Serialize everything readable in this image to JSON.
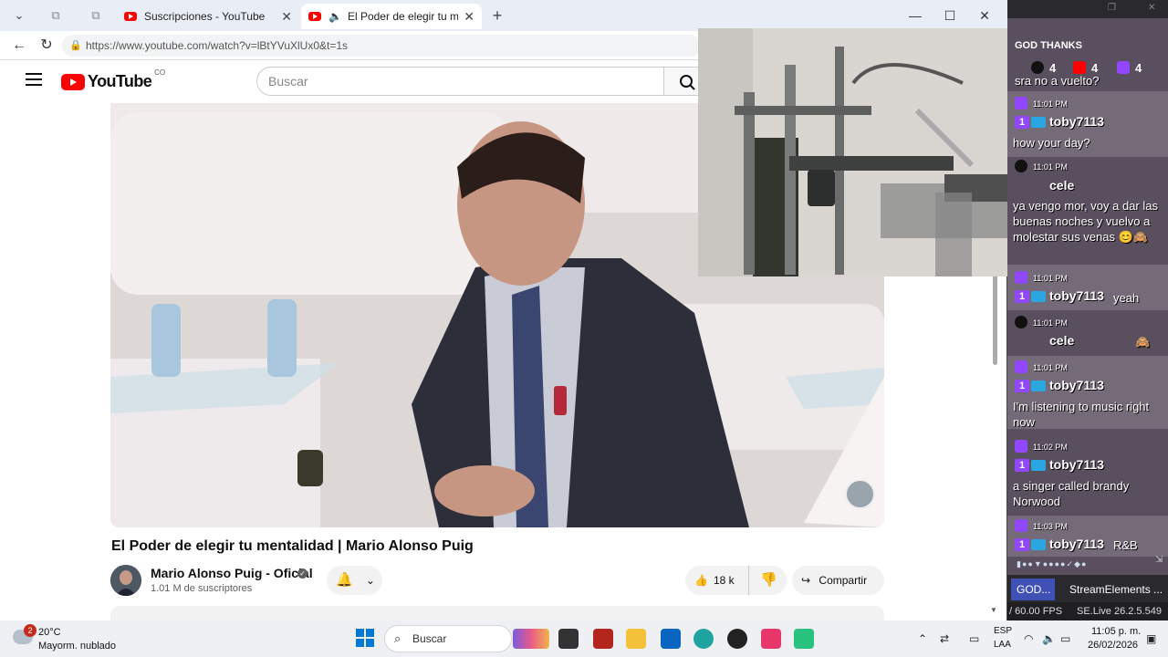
{
  "browser": {
    "tabs": [
      {
        "label": "Suscripciones - YouTube"
      },
      {
        "label": "El Poder de elegir tu mentalidad | Mario Alonso Puig"
      }
    ],
    "url": "https://www.youtube.com/watch?v=lBtYVuXlUx0&t=1s"
  },
  "youtube": {
    "logo_text": "YouTube",
    "country_code": "CO",
    "search_placeholder": "Buscar",
    "video_title": "El Poder de elegir tu mentalidad | Mario Alonso Puig",
    "channel_name": "Mario Alonso Puig - Oficial",
    "subscribers": "1.01 M de suscriptores",
    "likes": "18 k",
    "share_label": "Compartir"
  },
  "chat": {
    "header": "GOD THANKS",
    "counters": {
      "tiktok": "4",
      "youtube": "4",
      "twitch": "4"
    },
    "partial_top_line": "sra no a vuelto?",
    "messages": [
      {
        "platform": "twitch",
        "time": "11:01 PM",
        "user": "toby7113",
        "text": "how your day?"
      },
      {
        "platform": "tiktok",
        "time": "11:01 PM",
        "user": "cele",
        "text": "ya vengo mor, voy a dar las buenas noches y vuelvo a molestar sus venas 😊🙈"
      },
      {
        "platform": "twitch",
        "time": "11:01 PM",
        "user": "toby7113",
        "text": "yeah"
      },
      {
        "platform": "tiktok",
        "time": "11:01 PM",
        "user": "cele",
        "text": "🙈"
      },
      {
        "platform": "twitch",
        "time": "11:01 PM",
        "user": "toby7113",
        "text": "I'm listening to music right now"
      },
      {
        "platform": "twitch",
        "time": "11:02 PM",
        "user": "toby7113",
        "text": "a singer called brandy Norwood"
      },
      {
        "platform": "twitch",
        "time": "11:03 PM",
        "user": "toby7113",
        "text": "R&B"
      }
    ],
    "tabs": [
      "GOD...",
      "StreamElements ..."
    ],
    "fps": "/ 60.00 FPS",
    "version": "SE.Live 26.2.5.549"
  },
  "taskbar": {
    "weather_temp": "20°C",
    "weather_desc": "Mayorm. nublado",
    "weather_badge": "2",
    "search_label": "Buscar",
    "lang_line1": "ESP",
    "lang_line2": "LAA",
    "time": "11:05 p. m.",
    "date": "26/02/2026"
  }
}
